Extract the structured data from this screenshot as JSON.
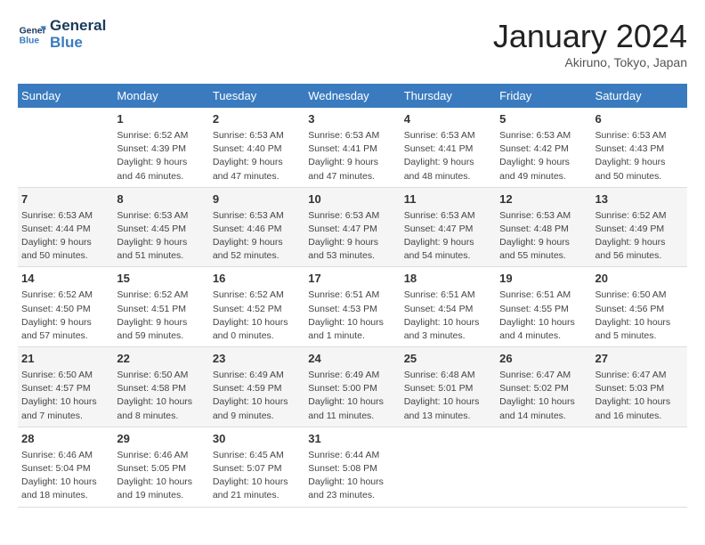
{
  "header": {
    "logo_line1": "General",
    "logo_line2": "Blue",
    "month_title": "January 2024",
    "location": "Akiruno, Tokyo, Japan"
  },
  "days_of_week": [
    "Sunday",
    "Monday",
    "Tuesday",
    "Wednesday",
    "Thursday",
    "Friday",
    "Saturday"
  ],
  "weeks": [
    [
      {
        "day": "",
        "info": ""
      },
      {
        "day": "1",
        "info": "Sunrise: 6:52 AM\nSunset: 4:39 PM\nDaylight: 9 hours\nand 46 minutes."
      },
      {
        "day": "2",
        "info": "Sunrise: 6:53 AM\nSunset: 4:40 PM\nDaylight: 9 hours\nand 47 minutes."
      },
      {
        "day": "3",
        "info": "Sunrise: 6:53 AM\nSunset: 4:41 PM\nDaylight: 9 hours\nand 47 minutes."
      },
      {
        "day": "4",
        "info": "Sunrise: 6:53 AM\nSunset: 4:41 PM\nDaylight: 9 hours\nand 48 minutes."
      },
      {
        "day": "5",
        "info": "Sunrise: 6:53 AM\nSunset: 4:42 PM\nDaylight: 9 hours\nand 49 minutes."
      },
      {
        "day": "6",
        "info": "Sunrise: 6:53 AM\nSunset: 4:43 PM\nDaylight: 9 hours\nand 50 minutes."
      }
    ],
    [
      {
        "day": "7",
        "info": "Sunrise: 6:53 AM\nSunset: 4:44 PM\nDaylight: 9 hours\nand 50 minutes."
      },
      {
        "day": "8",
        "info": "Sunrise: 6:53 AM\nSunset: 4:45 PM\nDaylight: 9 hours\nand 51 minutes."
      },
      {
        "day": "9",
        "info": "Sunrise: 6:53 AM\nSunset: 4:46 PM\nDaylight: 9 hours\nand 52 minutes."
      },
      {
        "day": "10",
        "info": "Sunrise: 6:53 AM\nSunset: 4:47 PM\nDaylight: 9 hours\nand 53 minutes."
      },
      {
        "day": "11",
        "info": "Sunrise: 6:53 AM\nSunset: 4:47 PM\nDaylight: 9 hours\nand 54 minutes."
      },
      {
        "day": "12",
        "info": "Sunrise: 6:53 AM\nSunset: 4:48 PM\nDaylight: 9 hours\nand 55 minutes."
      },
      {
        "day": "13",
        "info": "Sunrise: 6:52 AM\nSunset: 4:49 PM\nDaylight: 9 hours\nand 56 minutes."
      }
    ],
    [
      {
        "day": "14",
        "info": "Sunrise: 6:52 AM\nSunset: 4:50 PM\nDaylight: 9 hours\nand 57 minutes."
      },
      {
        "day": "15",
        "info": "Sunrise: 6:52 AM\nSunset: 4:51 PM\nDaylight: 9 hours\nand 59 minutes."
      },
      {
        "day": "16",
        "info": "Sunrise: 6:52 AM\nSunset: 4:52 PM\nDaylight: 10 hours\nand 0 minutes."
      },
      {
        "day": "17",
        "info": "Sunrise: 6:51 AM\nSunset: 4:53 PM\nDaylight: 10 hours\nand 1 minute."
      },
      {
        "day": "18",
        "info": "Sunrise: 6:51 AM\nSunset: 4:54 PM\nDaylight: 10 hours\nand 3 minutes."
      },
      {
        "day": "19",
        "info": "Sunrise: 6:51 AM\nSunset: 4:55 PM\nDaylight: 10 hours\nand 4 minutes."
      },
      {
        "day": "20",
        "info": "Sunrise: 6:50 AM\nSunset: 4:56 PM\nDaylight: 10 hours\nand 5 minutes."
      }
    ],
    [
      {
        "day": "21",
        "info": "Sunrise: 6:50 AM\nSunset: 4:57 PM\nDaylight: 10 hours\nand 7 minutes."
      },
      {
        "day": "22",
        "info": "Sunrise: 6:50 AM\nSunset: 4:58 PM\nDaylight: 10 hours\nand 8 minutes."
      },
      {
        "day": "23",
        "info": "Sunrise: 6:49 AM\nSunset: 4:59 PM\nDaylight: 10 hours\nand 9 minutes."
      },
      {
        "day": "24",
        "info": "Sunrise: 6:49 AM\nSunset: 5:00 PM\nDaylight: 10 hours\nand 11 minutes."
      },
      {
        "day": "25",
        "info": "Sunrise: 6:48 AM\nSunset: 5:01 PM\nDaylight: 10 hours\nand 13 minutes."
      },
      {
        "day": "26",
        "info": "Sunrise: 6:47 AM\nSunset: 5:02 PM\nDaylight: 10 hours\nand 14 minutes."
      },
      {
        "day": "27",
        "info": "Sunrise: 6:47 AM\nSunset: 5:03 PM\nDaylight: 10 hours\nand 16 minutes."
      }
    ],
    [
      {
        "day": "28",
        "info": "Sunrise: 6:46 AM\nSunset: 5:04 PM\nDaylight: 10 hours\nand 18 minutes."
      },
      {
        "day": "29",
        "info": "Sunrise: 6:46 AM\nSunset: 5:05 PM\nDaylight: 10 hours\nand 19 minutes."
      },
      {
        "day": "30",
        "info": "Sunrise: 6:45 AM\nSunset: 5:07 PM\nDaylight: 10 hours\nand 21 minutes."
      },
      {
        "day": "31",
        "info": "Sunrise: 6:44 AM\nSunset: 5:08 PM\nDaylight: 10 hours\nand 23 minutes."
      },
      {
        "day": "",
        "info": ""
      },
      {
        "day": "",
        "info": ""
      },
      {
        "day": "",
        "info": ""
      }
    ]
  ]
}
